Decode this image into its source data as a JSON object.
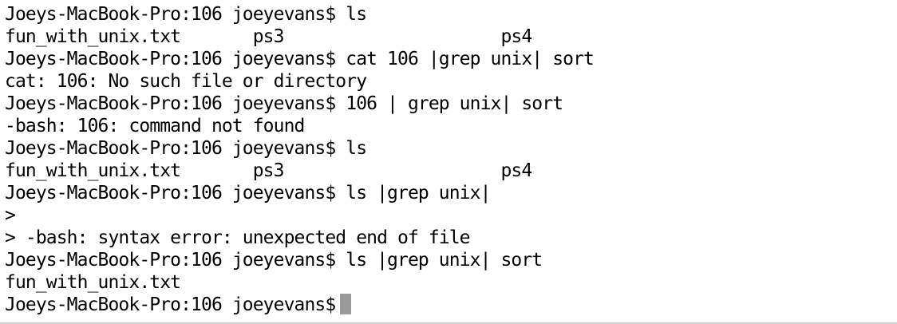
{
  "terminal": {
    "lines": [
      "Joeys-MacBook-Pro:106 joeyevans$ ls",
      "fun_with_unix.txt       ps3                     ps4",
      "Joeys-MacBook-Pro:106 joeyevans$ cat 106 |grep unix| sort",
      "cat: 106: No such file or directory",
      "Joeys-MacBook-Pro:106 joeyevans$ 106 | grep unix| sort",
      "-bash: 106: command not found",
      "Joeys-MacBook-Pro:106 joeyevans$ ls",
      "fun_with_unix.txt       ps3                     ps4",
      "Joeys-MacBook-Pro:106 joeyevans$ ls |grep unix|",
      ">",
      "> -bash: syntax error: unexpected end of file",
      "Joeys-MacBook-Pro:106 joeyevans$ ls |grep unix| sort",
      "fun_with_unix.txt"
    ],
    "prompt": "Joeys-MacBook-Pro:106 joeyevans$",
    "cursor_color": "#9a9a9a",
    "text_color": "#000000",
    "background_color": "#ffffff"
  }
}
